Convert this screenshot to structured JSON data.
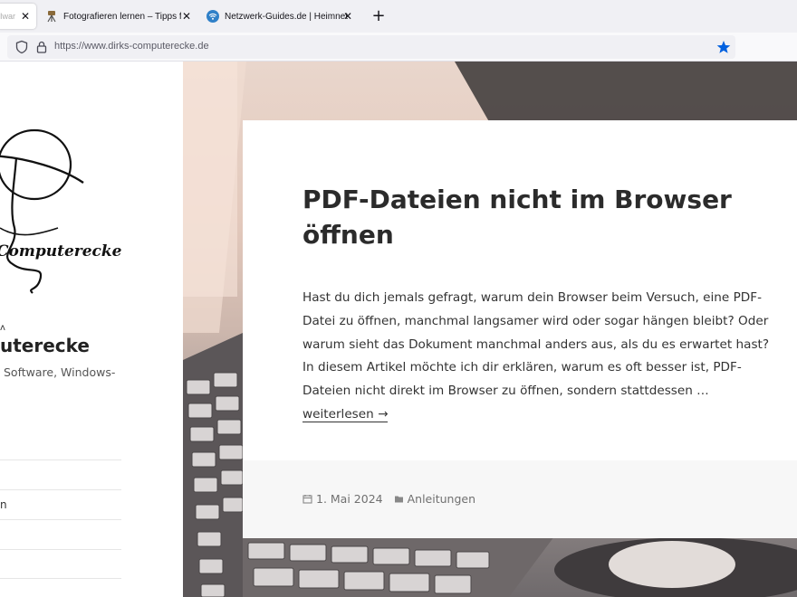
{
  "browser": {
    "tabs": [
      {
        "title": "Iwar",
        "active": true,
        "favicon": "none"
      },
      {
        "title": "Fotografieren lernen – Tipps für",
        "active": false,
        "favicon": "camera-tripod-icon"
      },
      {
        "title": "Netzwerk-Guides.de | Heimnetz",
        "active": false,
        "favicon": "wifi-icon"
      }
    ],
    "new_tab": "+",
    "url": "https://www.dirks-computerecke.de",
    "accent_color": "#0060df"
  },
  "sidebar": {
    "logo_text": "Computerecke",
    "site_dot": "ʌ",
    "site_title": "uterecke",
    "site_description": "Software, Windows-",
    "menu": [
      {
        "label": ""
      },
      {
        "label": "n"
      },
      {
        "label": ""
      },
      {
        "label": ""
      }
    ]
  },
  "article": {
    "title": "PDF-Dateien nicht im Browser öffnen",
    "excerpt": "Hast du dich jemals gefragt, warum dein Browser beim Versuch, eine PDF-Datei zu öffnen, manchmal langsamer wird oder sogar hängen bleibt? Oder warum sieht das Dokument manchmal anders aus, als du es erwartet hast? In diesem Artikel möchte ich dir erklären, warum es oft besser ist, PDF-Dateien nicht direkt im Browser zu öffnen, sondern stattdessen …",
    "read_more": "weiterlesen →",
    "date": "1. Mai 2024",
    "category": "Anleitungen"
  }
}
